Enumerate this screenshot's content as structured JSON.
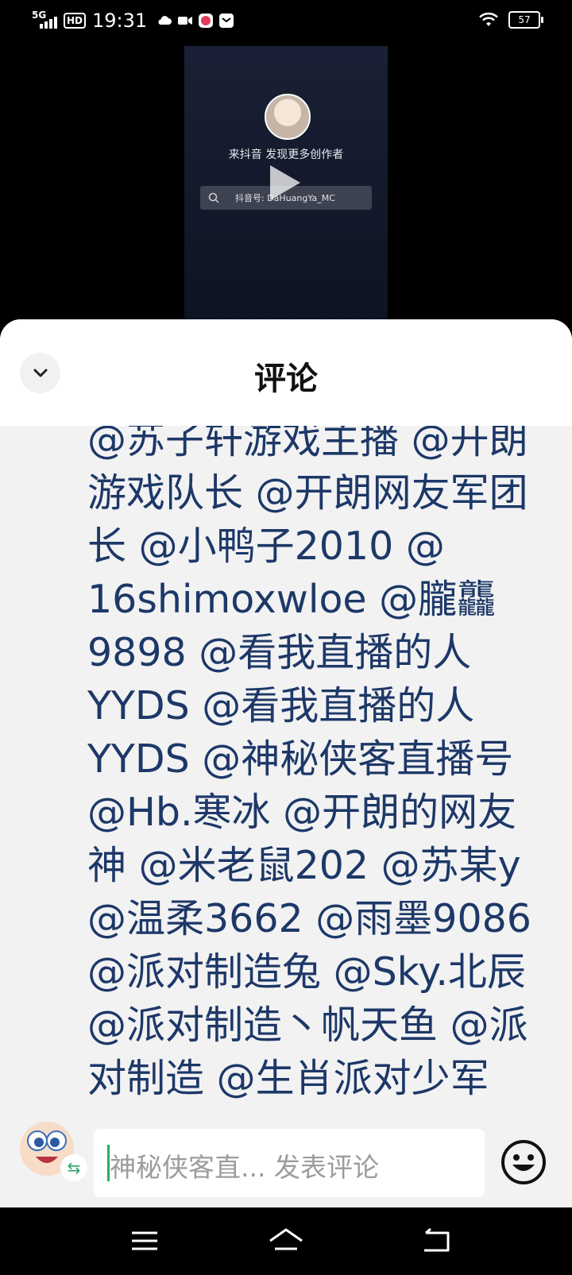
{
  "status_bar": {
    "network": "5G",
    "hd": "HD",
    "time": "19:31",
    "battery": "57"
  },
  "video": {
    "promo_text": "来抖音 发现更多创作者",
    "search_text": "抖音号: DaHuangYa_MC"
  },
  "comments_sheet": {
    "title": "评论",
    "comment_lines": [
      "@苏子轩游戏主播 @开朗",
      "游戏队长 @开朗网友军团",
      "长 @小鸭子2010 @",
      "16shimoxwloe @朧龘",
      "9898 @看我直播的人",
      "YYDS @看我直播的人",
      "YYDS @神秘侠客直播号",
      "@Hb.寒冰 @开朗的网友",
      "神 @米老鼠202 @苏某y",
      "@温柔3662 @雨墨9086",
      "@派对制造兔 @Sky.北辰",
      "@派对制造丶帆天鱼 @派",
      "对制造 @生肖派对少军"
    ]
  },
  "input": {
    "placeholder": "神秘侠客直... 发表评论",
    "swap_icon": "⇆"
  },
  "colors": {
    "comment_text": "#1d3868",
    "caret": "#26b05c",
    "sheet_bg": "#f2f2f2"
  }
}
